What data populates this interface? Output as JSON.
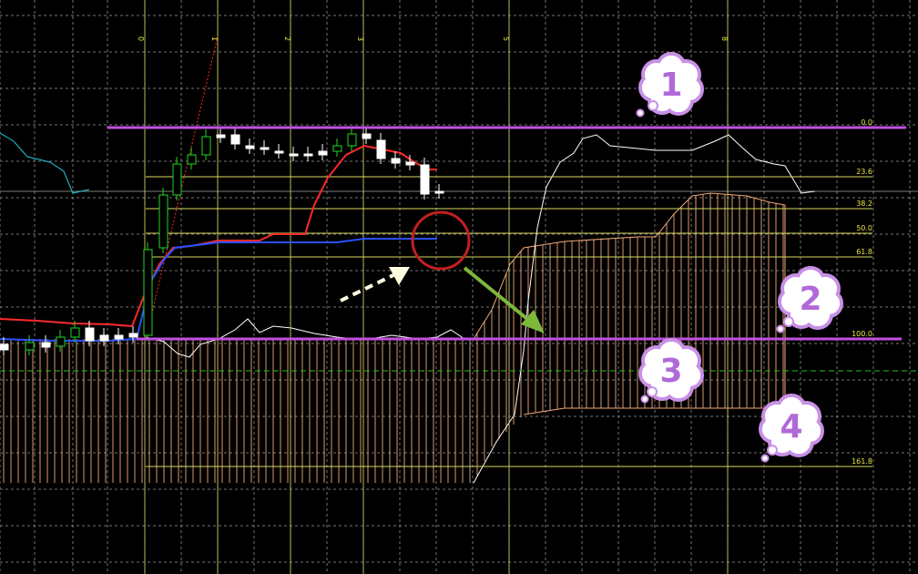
{
  "colors": {
    "background": "#000000",
    "grid": "#8a8a8a",
    "fib_line": "#d8d860",
    "fib_label": "#e8e840",
    "time_line": "#c8c860",
    "purple_level": "#c050e0",
    "cloud": "#f0a878",
    "tenkan": "#ff2a2a",
    "kijun": "#2a50ff",
    "chikou": "#ffffff",
    "lagging_cyan": "#20c8d8",
    "candle_up_fill": "#000000",
    "candle_up_border": "#20d820",
    "candle_down_fill": "#ffffff",
    "marker_circle": "#c02020",
    "arrow_green": "#7cb83c",
    "arrow_dashed": "#fffde0",
    "bubble_fill": "#ffffff",
    "bubble_border": "#c890e8",
    "bubble_text": "#b06ad8"
  },
  "fib_levels": [
    {
      "label": "0.0"
    },
    {
      "label": "23.6"
    },
    {
      "label": "38.2"
    },
    {
      "label": "50.0"
    },
    {
      "label": "61.8"
    },
    {
      "label": "100.0"
    },
    {
      "label": "161.8"
    }
  ],
  "time_zones": [
    "0",
    "1",
    "2",
    "3",
    "5",
    "8"
  ],
  "bubbles": [
    {
      "label": "1",
      "name": "bubble-1"
    },
    {
      "label": "2",
      "name": "bubble-2"
    },
    {
      "label": "3",
      "name": "bubble-3"
    },
    {
      "label": "4",
      "name": "bubble-4"
    }
  ],
  "annotations": {
    "circle": "red-circle-marker",
    "green_arrow": "green-arrow-down-right",
    "dashed_arrow": "dashed-arrow-up-right"
  }
}
